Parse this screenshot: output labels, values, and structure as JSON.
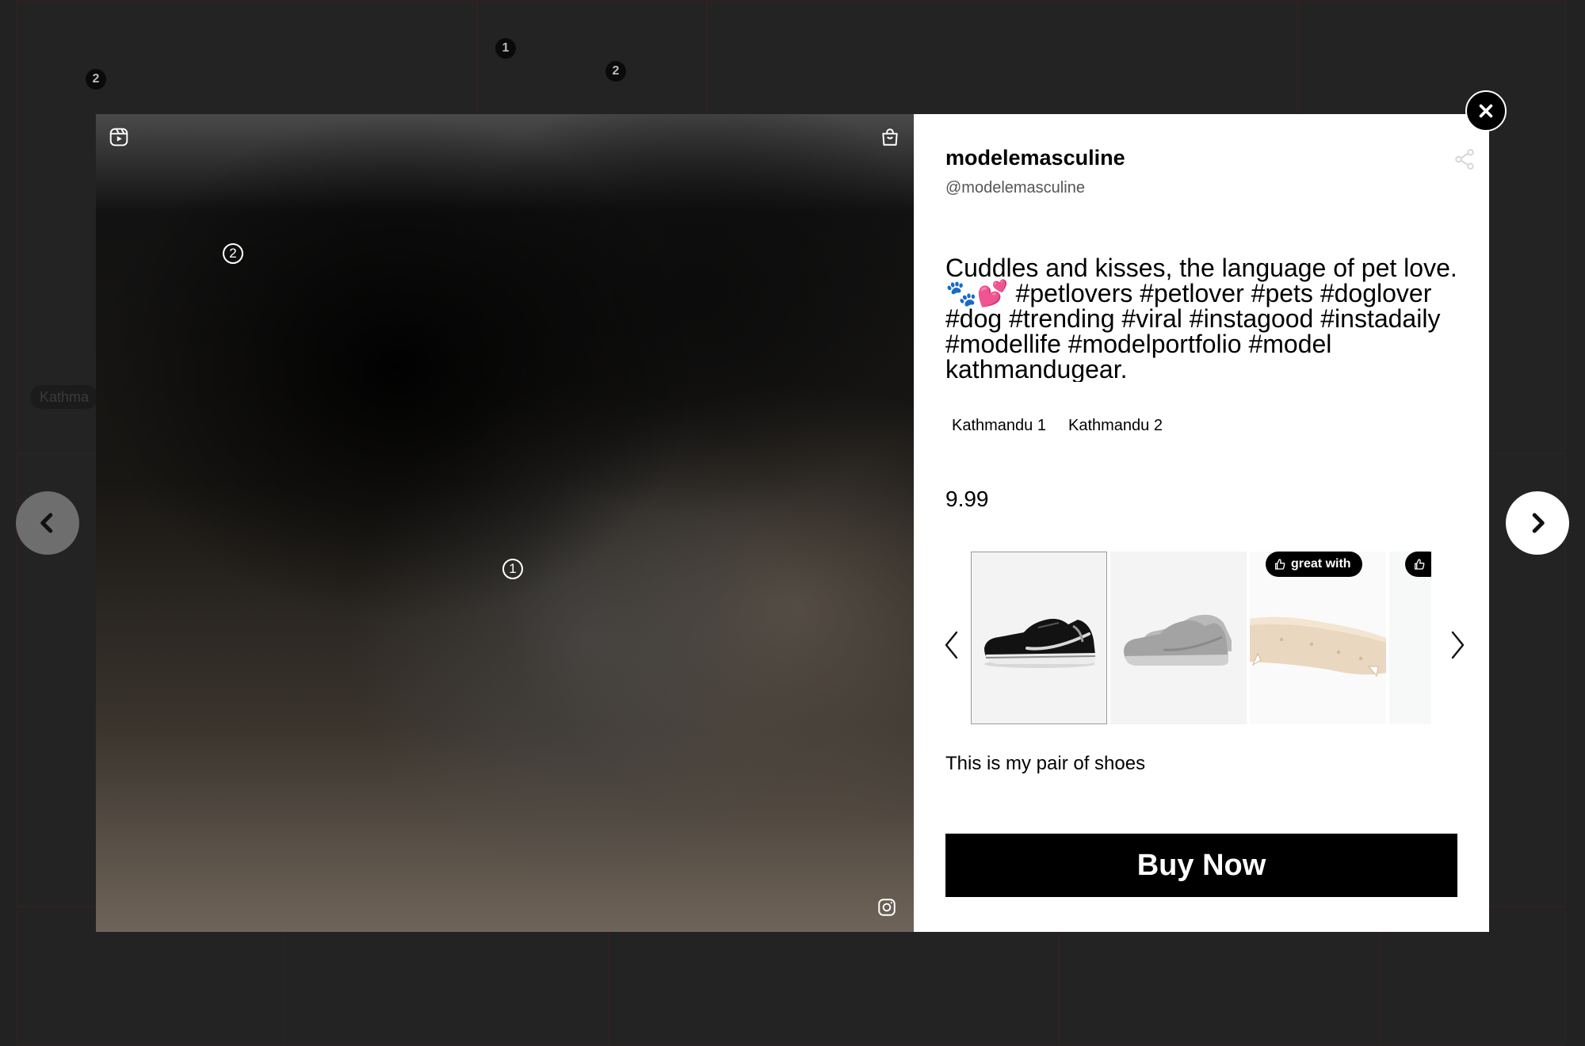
{
  "background": {
    "tile_badges": [
      "2",
      "1",
      "2"
    ],
    "tile_chip": "Kathma"
  },
  "modal": {
    "media": {
      "reel_icon": "reel-icon",
      "bag_icon": "shopping-bag-icon",
      "instagram_icon": "instagram-icon",
      "tag_pins": [
        "2",
        "1"
      ]
    },
    "post": {
      "username": "modelemasculine",
      "handle": "@modelemasculine",
      "caption": "Cuddles and kisses, the language of pet love. 🐾💕 #petlovers #petlover #pets #doglover #dog #trending #viral #instagood #instadaily #modellife #modelportfolio #model kathmandugear.",
      "tags": [
        "Kathmandu 1",
        "Kathmandu 2"
      ],
      "price": "9.99",
      "description": "This is my pair of shoes",
      "buy_label": "Buy Now"
    },
    "products": [
      {
        "name": "black-running-shoe",
        "selected": true
      },
      {
        "name": "grey-running-shoe",
        "selected": false
      },
      {
        "name": "cream-shoe-sole",
        "selected": false,
        "badge": "great with"
      },
      {
        "name": "partial-product",
        "selected": false,
        "badge": ""
      }
    ]
  },
  "colors": {
    "accent": "#000000",
    "panel_bg": "#ffffff",
    "backdrop": "#222222"
  }
}
